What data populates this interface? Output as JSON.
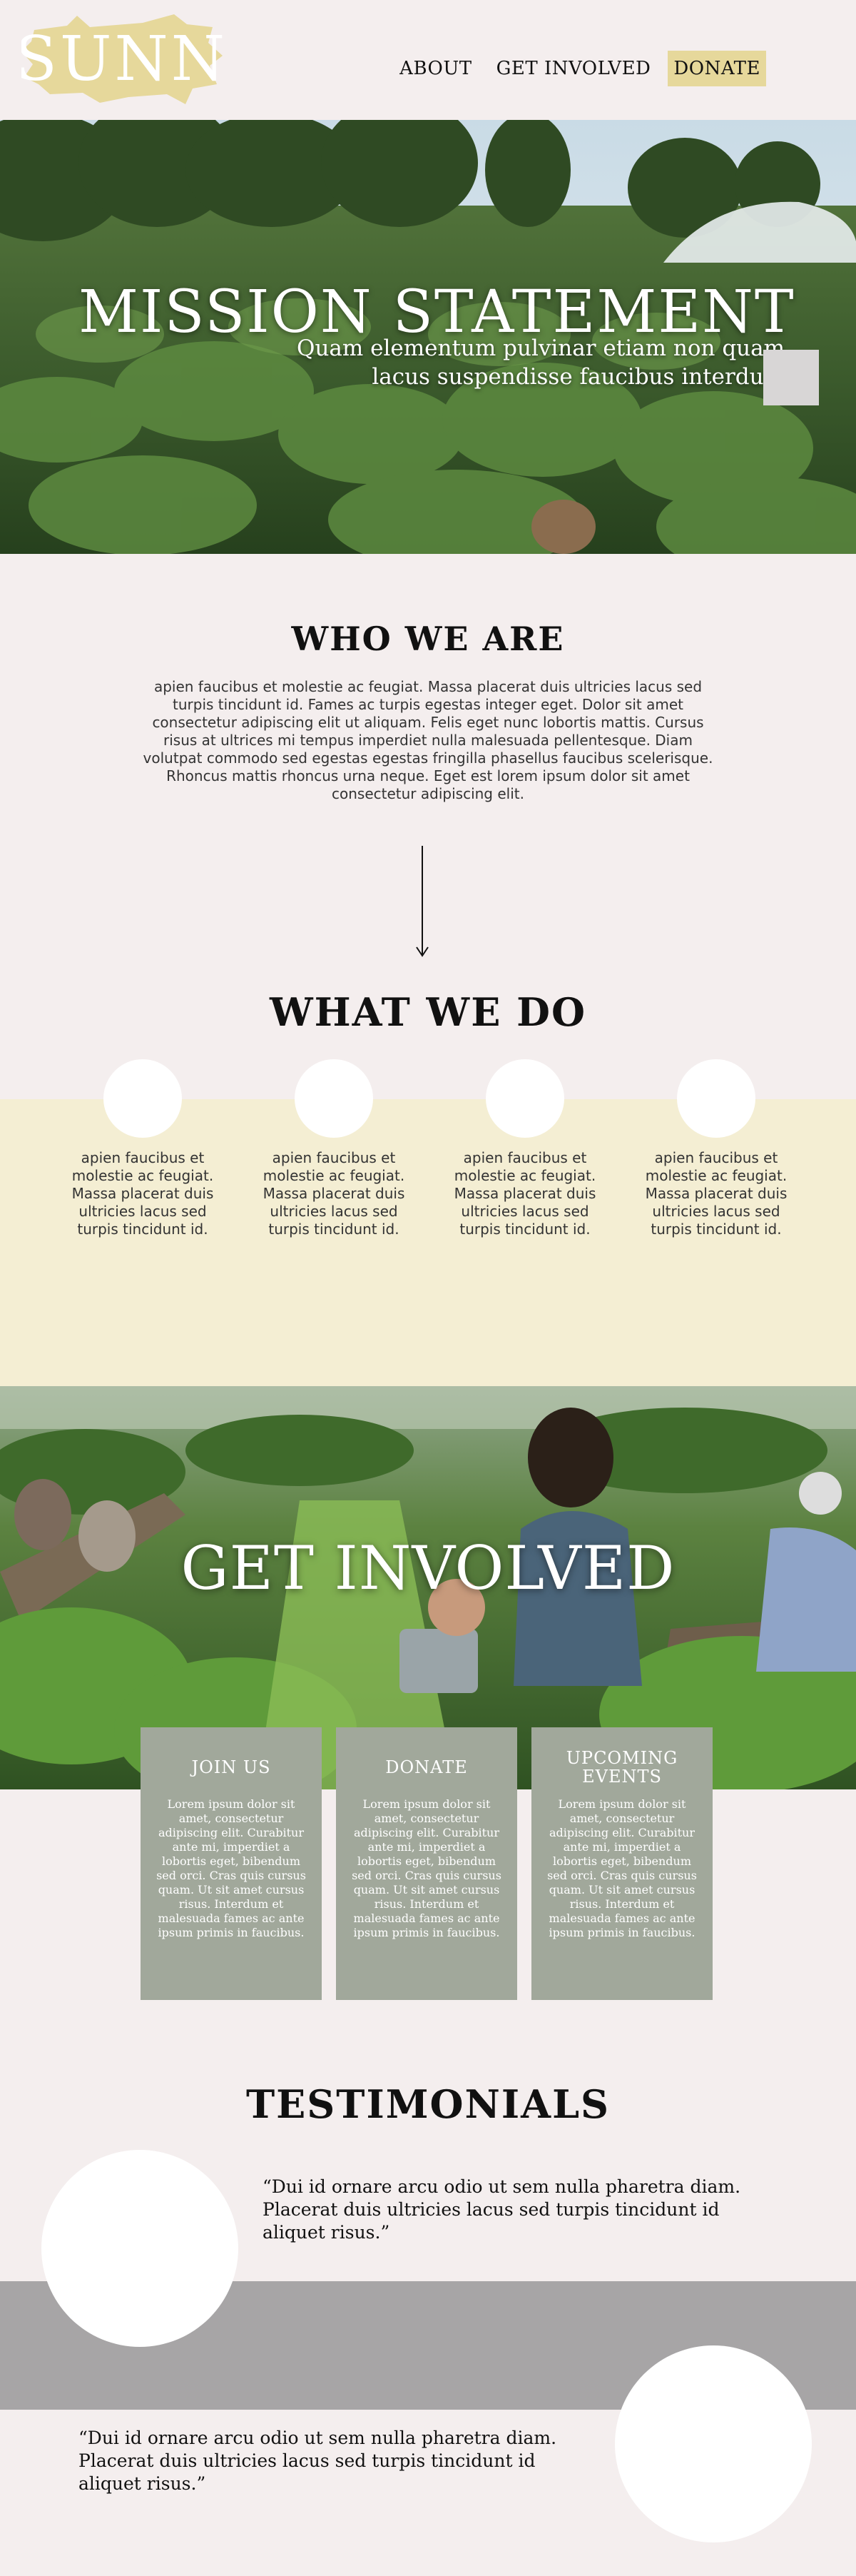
{
  "header": {
    "logo_text": "SUNN",
    "nav": [
      {
        "label": "ABOUT"
      },
      {
        "label": "GET INVOLVED"
      },
      {
        "label": "DONATE"
      }
    ]
  },
  "hero": {
    "title": "MISSION STATEMENT",
    "subtitle": "Quam elementum pulvinar etiam non quam lacus suspendisse faucibus interdum"
  },
  "who": {
    "title": "WHO WE ARE",
    "text": "apien faucibus et molestie ac feugiat. Massa placerat duis ultricies lacus sed turpis tincidunt id. Fames ac turpis egestas integer eget. Dolor sit amet consectetur adipiscing elit ut aliquam. Felis eget nunc lobortis mattis. Cursus risus at ultrices mi tempus imperdiet nulla malesuada pellentesque. Diam volutpat commodo sed egestas egestas fringilla phasellus faucibus scelerisque. Rhoncus mattis rhoncus urna neque. Eget est lorem ipsum dolor sit amet consectetur adipiscing elit."
  },
  "what": {
    "title": "WHAT WE DO",
    "items": [
      {
        "text": "apien faucibus et molestie ac feugiat. Massa placerat duis ultricies lacus sed turpis tincidunt id."
      },
      {
        "text": "apien faucibus et molestie ac feugiat. Massa placerat duis ultricies lacus sed turpis tincidunt id."
      },
      {
        "text": "apien faucibus et molestie ac feugiat. Massa placerat duis ultricies lacus sed turpis tincidunt id."
      },
      {
        "text": "apien faucibus et molestie ac feugiat. Massa placerat duis ultricies lacus sed turpis tincidunt id."
      }
    ]
  },
  "involved": {
    "title": "GET INVOLVED",
    "cards": [
      {
        "heading": "JOIN US",
        "text": "Lorem ipsum dolor sit amet, consectetur adipiscing elit. Curabitur ante mi, imperdiet a lobortis eget, bibendum sed orci. Cras quis cursus quam. Ut sit amet cursus risus. Interdum et malesuada fames ac ante ipsum primis in faucibus."
      },
      {
        "heading": "DONATE",
        "text": "Lorem ipsum dolor sit amet, consectetur adipiscing elit. Curabitur ante mi, imperdiet a lobortis eget, bibendum sed orci. Cras quis cursus quam. Ut sit amet cursus risus. Interdum et malesuada fames ac ante ipsum primis in faucibus."
      },
      {
        "heading": "UPCOMING EVENTS",
        "text": "Lorem ipsum dolor sit amet, consectetur adipiscing elit. Curabitur ante mi, imperdiet a lobortis eget, bibendum sed orci. Cras quis cursus quam. Ut sit amet cursus risus. Interdum et malesuada fames ac ante ipsum primis in faucibus."
      }
    ]
  },
  "testimonials": {
    "title": "TESTIMONIALS",
    "quotes": [
      {
        "text": "“Dui id ornare arcu odio ut sem nulla pharetra diam. Placerat duis ultricies lacus sed turpis tincidunt id aliquet risus.”"
      },
      {
        "text": "“Dui id ornare arcu odio ut sem nulla pharetra diam. Placerat duis ultricies lacus sed turpis tincidunt id aliquet risus.”"
      }
    ]
  },
  "colors": {
    "background": "#f4eeee",
    "accent_yellow": "#e6d89b",
    "band_cream": "#f4eed3",
    "card_sage": "#a1a89b",
    "gray_band": "#a7a5a6"
  }
}
